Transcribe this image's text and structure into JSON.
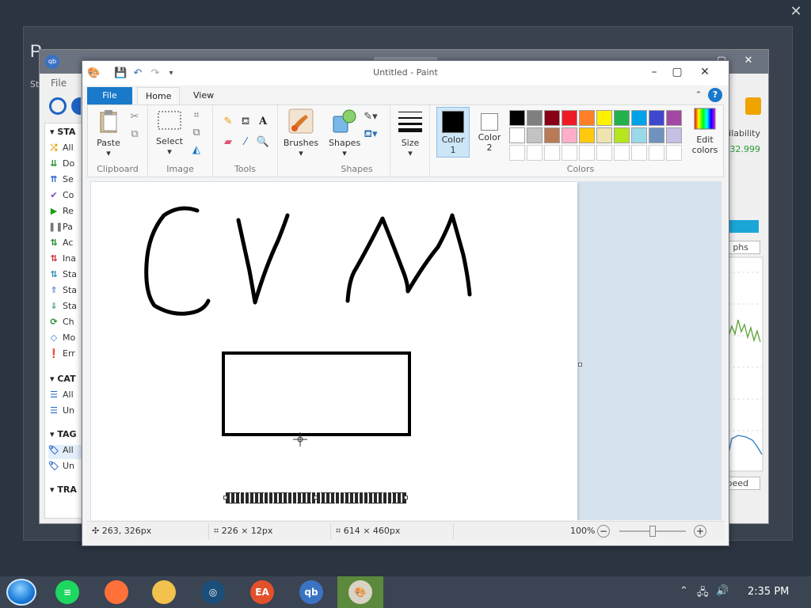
{
  "screen": {
    "overlay_close": "✕"
  },
  "bg_dialog": {
    "title": "P",
    "subtitle": "St"
  },
  "qbittorrent": {
    "menu_file": "File",
    "sections": {
      "status": "STA",
      "categories": "CAT",
      "tags": "TAG",
      "trackers": "TRA"
    },
    "status_items": [
      "All",
      "Do",
      "Se",
      "Co",
      "Re",
      "Pa",
      "Ac",
      "Ina",
      "Sta",
      "Sta",
      "Sta",
      "Ch",
      "Mo",
      "Err"
    ],
    "category_items": [
      "All",
      "Un"
    ],
    "tag_items": [
      "All",
      "Un"
    ],
    "right_panel": {
      "availability_label": "ailability",
      "availability_value": "32.999",
      "graphs_label": "phs",
      "speed_label": "peed"
    }
  },
  "paint": {
    "title": "Untitled - Paint",
    "tabs": {
      "file": "File",
      "home": "Home",
      "view": "View"
    },
    "groups": {
      "clipboard": "Clipboard",
      "image": "Image",
      "tools": "Tools",
      "shapes": "Shapes",
      "colors": "Colors"
    },
    "buttons": {
      "paste": "Paste",
      "select": "Select",
      "brushes": "Brushes",
      "shapes": "Shapes",
      "size": "Size",
      "color1": "Color\n1",
      "color1_a": "Color",
      "color1_b": "1",
      "color2_a": "Color",
      "color2_b": "2",
      "edit_colors_a": "Edit",
      "edit_colors_b": "colors"
    },
    "palette_row1": [
      "#000000",
      "#7f7f7f",
      "#880015",
      "#ed1c24",
      "#ff7f27",
      "#fff200",
      "#22b14c",
      "#00a2e8",
      "#3f48cc",
      "#a349a4"
    ],
    "palette_row2": [
      "#ffffff",
      "#c3c3c3",
      "#b97a57",
      "#ffaec9",
      "#ffc90e",
      "#efe4b0",
      "#b5e61d",
      "#99d9ea",
      "#7092be",
      "#c8bfe7"
    ],
    "color1_value": "#000000",
    "color2_value": "#ffffff",
    "status": {
      "cursor_pos": "263, 326px",
      "selection_size": "226 × 12px",
      "canvas_size": "614 × 460px",
      "zoom": "100%"
    }
  },
  "taskbar": {
    "apps": [
      {
        "name": "spotify",
        "glyph": "≡",
        "color": "#1ed760"
      },
      {
        "name": "firefox",
        "glyph": "",
        "color": "#ff7139"
      },
      {
        "name": "files",
        "glyph": "",
        "color": "#f2c14e"
      },
      {
        "name": "steam",
        "glyph": "◎",
        "color": "#1b4f7a"
      },
      {
        "name": "ea",
        "glyph": "EA",
        "color": "#e2512b"
      },
      {
        "name": "qbittorrent",
        "glyph": "qb",
        "color": "#3b73c4"
      },
      {
        "name": "paint",
        "glyph": "🎨",
        "color": "#d9d3c5"
      }
    ],
    "clock": "2:35 PM"
  }
}
